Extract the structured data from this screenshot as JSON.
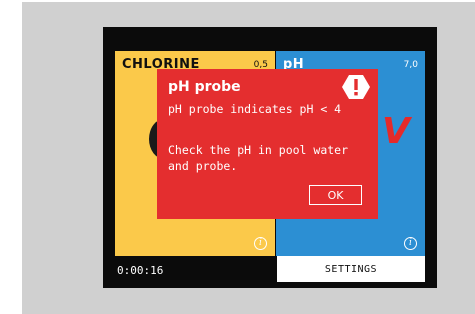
{
  "screen": {
    "tiles": [
      {
        "title": "CHLORINE",
        "value": "0,5"
      },
      {
        "title": "pH",
        "value": "7,0"
      }
    ],
    "timer": "0:00:16",
    "settings_label": "SETTINGS"
  },
  "dialog": {
    "title": "pH probe",
    "message": "pH probe indicates pH < 4",
    "instruction": "Check the pH in pool water and probe.",
    "ok_label": "OK",
    "icon": "alert-hexagon-icon"
  },
  "colors": {
    "chlorine_tile": "#fbc94a",
    "ph_tile": "#2c8fd3",
    "dialog_bg": "#e42e2f",
    "screen_bg": "#0b0b0b"
  }
}
